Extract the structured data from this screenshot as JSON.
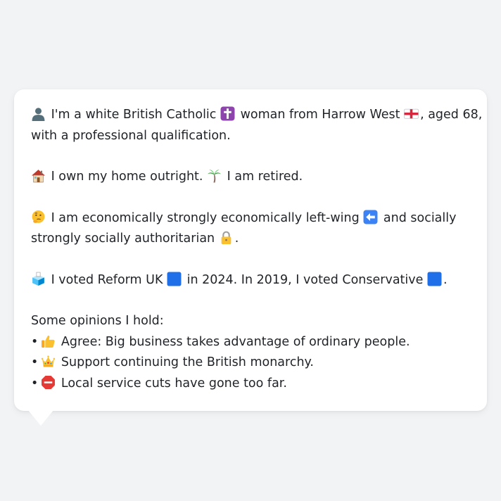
{
  "profile": {
    "intro_a": "I'm a white British Catholic",
    "intro_b": "woman from Harrow West",
    "intro_c": ", aged 68,",
    "intro_d": "with a professional qualification.",
    "home": "I own my home outright.",
    "work": "I am retired.",
    "econ_a": "I am economically strongly economically left-wing",
    "econ_b": "and socially",
    "social": "strongly socially authoritarian",
    "vote_a": "I voted Reform UK",
    "vote_b": "in 2024. In 2019, I voted Conservative",
    "opinions_heading": "Some opinions I hold:",
    "opinions": [
      {
        "text": "Agree: Big business takes advantage of ordinary people.",
        "icon": "thumbs-up-icon"
      },
      {
        "text": "Support continuing the British monarchy.",
        "icon": "crown-icon"
      },
      {
        "text": "Local service cuts have gone too far.",
        "icon": "stop-sign-icon"
      }
    ]
  },
  "punct": {
    "period": ".",
    "bullet": "•"
  },
  "icons": [
    "person-icon",
    "latin-cross-icon",
    "england-flag-icon",
    "house-icon",
    "palm-tree-icon",
    "thinking-face-icon",
    "left-arrow-icon",
    "lock-icon",
    "ballot-box-icon",
    "blue-square-icon"
  ],
  "colors": {
    "background": "#f1f3f5",
    "card": "#ffffff",
    "text": "#1f2328",
    "cross_tile": "#8e44ad",
    "arrow_tile": "#3b82f6",
    "party_square": "#1e6fe8"
  }
}
